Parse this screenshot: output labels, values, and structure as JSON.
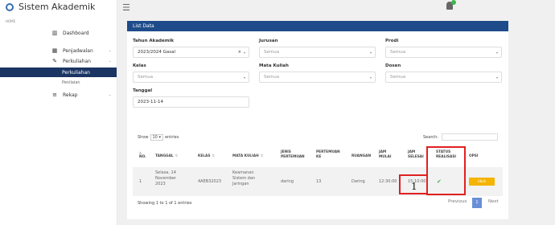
{
  "app": {
    "title": "Sistem Akademik"
  },
  "sidebar": {
    "home_label": "HOME",
    "items": [
      {
        "label": "Dashboard",
        "icon": "bar-chart-icon"
      },
      {
        "label": "Penjadwalan",
        "icon": "calendar-icon"
      },
      {
        "label": "Perkuliahan",
        "icon": "pencil-icon"
      },
      {
        "label": "Perkuliahan",
        "icon": ""
      },
      {
        "label": "Penilaian",
        "icon": ""
      },
      {
        "label": "Rekap",
        "icon": "list-icon"
      }
    ]
  },
  "panel": {
    "title": "List Data"
  },
  "filters": {
    "tahun_label": "Tahun Akademik",
    "tahun_value": "2023/2024 Gasal",
    "jurusan_label": "Jurusan",
    "jurusan_value": "Semua",
    "prodi_label": "Prodi",
    "prodi_value": "Semua",
    "kelas_label": "Kelas",
    "kelas_value": "Semua",
    "mk_label": "Mata Kuliah",
    "mk_value": "Semua",
    "dosen_label": "Dosen",
    "dosen_value": "Semua",
    "tanggal_label": "Tanggal",
    "tanggal_value": "2023-11-14"
  },
  "table": {
    "show_prefix": "Show",
    "show_value": "10",
    "show_suffix": "entries",
    "search_label": "Search:",
    "headers": {
      "no": "NO.",
      "tanggal": "TANGGAL",
      "kelas": "KELAS",
      "mk": "MATA KULIAH",
      "jenis1": "JENIS",
      "jenis2": "PERTEMUAN",
      "pert1": "PERTEMUAN",
      "pert2": "KE",
      "ruangan": "RUANGAN",
      "jm1": "JAM",
      "jm2": "MULAI",
      "js1": "JAM",
      "js2": "SELESAI",
      "st1": "STATUS",
      "st2": "REALISASI",
      "opsi": "OPSI"
    },
    "row": {
      "no": "1",
      "tanggal1": "Selasa, 14",
      "tanggal2": "November",
      "tanggal3": "2023",
      "kelas": "4AEB32023",
      "mk1": "Keamanan",
      "mk2": "Sistem dan",
      "mk3": "Jaringan",
      "jenis": "daring",
      "pert": "13",
      "ruangan": "Daring",
      "jam_mulai": "12:30:00",
      "jam_selesai": "15:10:00",
      "opsi": "Ubah"
    },
    "showing": "Showing 1 to 1 of 1 entries",
    "previous": "Previous",
    "page": "1",
    "next": "Next"
  },
  "annotation": {
    "label": "1"
  },
  "colors": {
    "header": "#1e4b8a",
    "active_nav": "#1a3463",
    "ubah": "#f4b400",
    "check": "#3cb54a",
    "highlight": "#e02020"
  }
}
